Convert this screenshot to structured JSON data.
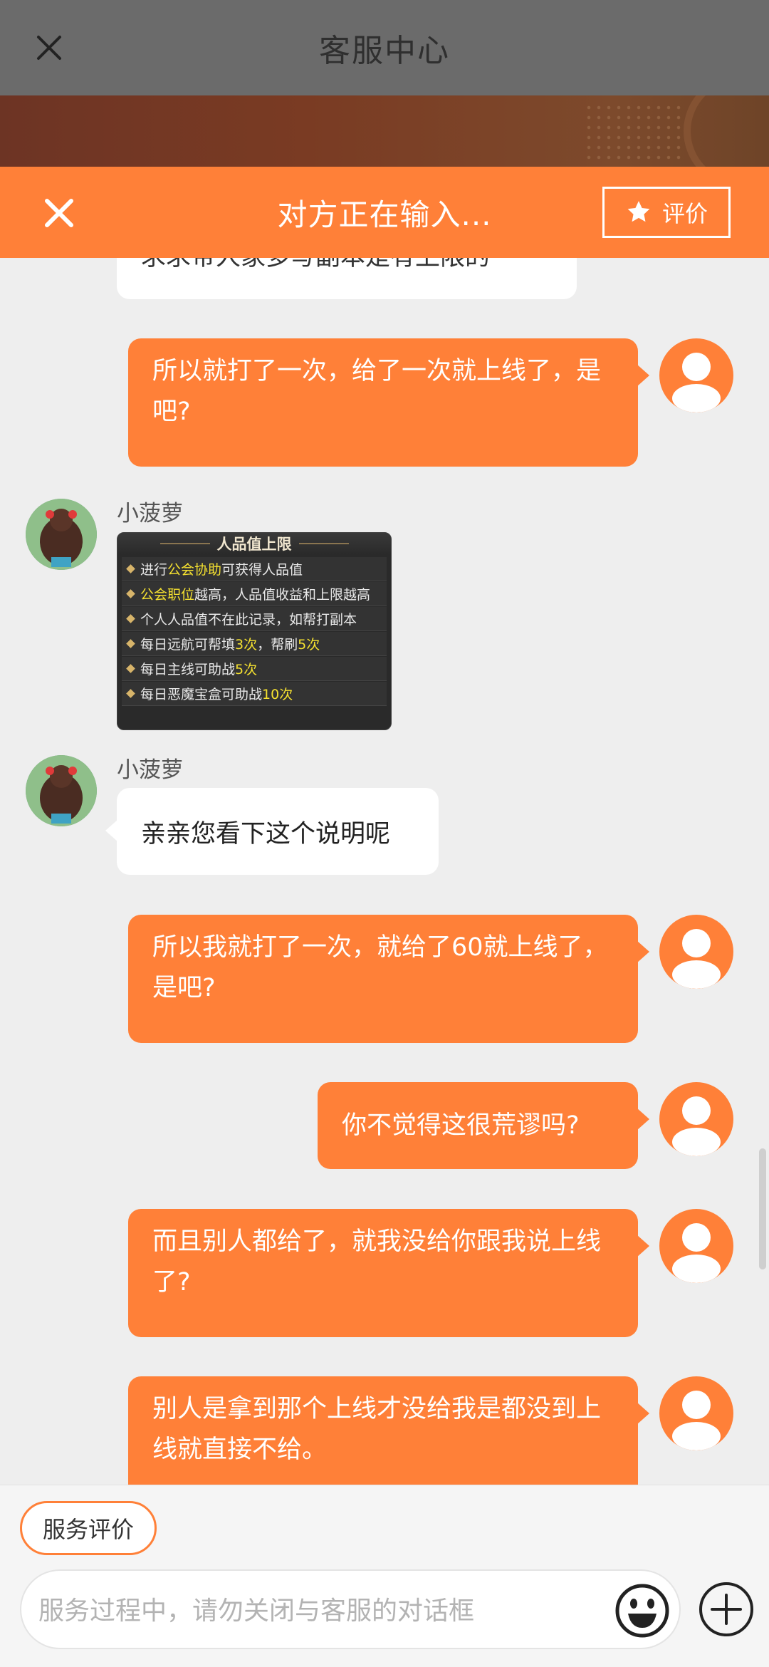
{
  "header": {
    "title": "客服中心",
    "close_icon": "close-icon"
  },
  "typing_bar": {
    "status": "对方正在输入...",
    "rate_label": "评价",
    "close_icon": "close-icon",
    "star_icon": "star-icon"
  },
  "colors": {
    "accent": "#ff8038",
    "header_dim": "#6b6b6b",
    "chat_bg": "#eeeeee"
  },
  "messages": {
    "partial_agent_text": "求求带人家多写副本是有上限的",
    "m1_user": "所以就打了一次，给了一次就上线了，是吧?",
    "m2_agent_name": "小菠萝",
    "m2_image": {
      "title": "人品值上限",
      "rows": [
        {
          "pre": "进行",
          "hl": "公会协助",
          "post": "可获得人品值"
        },
        {
          "pre": "",
          "hl": "公会职位",
          "post": "越高，人品值收益和上限越高"
        },
        {
          "pre": "个人人品值不在此记录，如帮打副本",
          "hl": "",
          "post": ""
        },
        {
          "pre": "每日远航可帮填",
          "hl": "3次",
          "post": "，帮刷",
          "hl2": "5次"
        },
        {
          "pre": "每日主线可助战",
          "hl": "5次",
          "post": ""
        },
        {
          "pre": "每日恶魔宝盒可助战",
          "hl": "10次",
          "post": ""
        }
      ]
    },
    "m3_agent_name": "小菠萝",
    "m3_agent": "亲亲您看下这个说明呢",
    "m4_user": "所以我就打了一次，就给了60就上线了，是吧?",
    "m5_user": "你不觉得这很荒谬吗?",
    "m6_user": "而且别人都给了，就我没给你跟我说上线了?",
    "m7_user": "别人是拿到那个上线才没给我是都没到上线就直接不给。"
  },
  "bottom": {
    "service_rating_label": "服务评价",
    "input_placeholder": "服务过程中，请勿关闭与客服的对话框",
    "input_value": "",
    "emoji_icon": "emoji-icon",
    "plus_icon": "plus-icon"
  }
}
